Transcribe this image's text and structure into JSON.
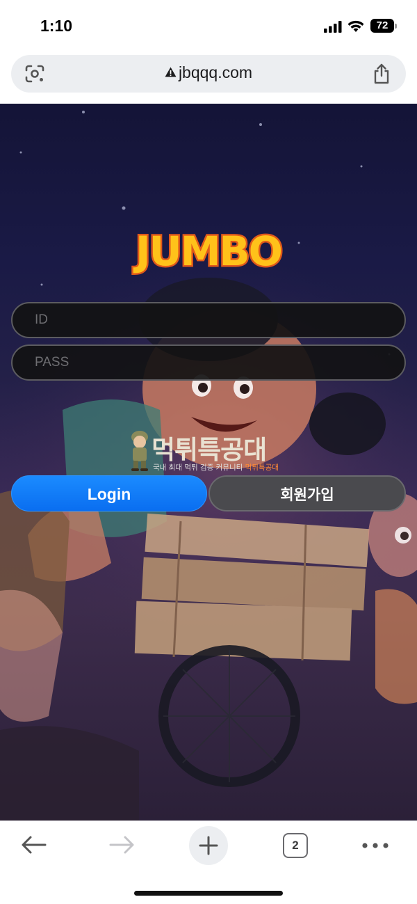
{
  "status_bar": {
    "time": "1:10",
    "battery": "72"
  },
  "browser": {
    "url": "jbqqq.com",
    "security": "warning-icon",
    "tab_count": "2",
    "icons": [
      "lens-icon",
      "share-icon",
      "back-arrow-icon",
      "forward-arrow-icon",
      "plus-icon",
      "tabs-icon",
      "more-icon"
    ]
  },
  "page": {
    "logo_text": "JUMBO",
    "id_placeholder": "ID",
    "pass_placeholder": "PASS",
    "login_label": "Login",
    "signup_label": "회원가입",
    "watermark_title": "먹튀특공대",
    "watermark_subtitle": "국내 최대 먹튀 검증 커뮤니티",
    "watermark_subtitle_accent": "먹튀특공대"
  },
  "colors": {
    "login_button": "#0a6ef0",
    "signup_button": "#4a4a4e",
    "logo_fill": "#ffc21a",
    "logo_outline": "#e0591a"
  }
}
